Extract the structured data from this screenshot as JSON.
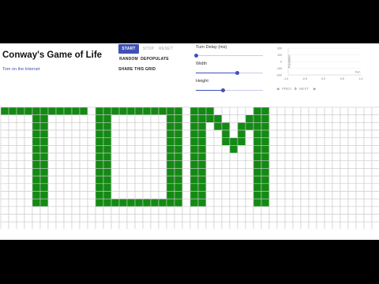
{
  "header": {
    "title": "Conway's Game of Life",
    "link": "Tom on the Internet"
  },
  "controls": {
    "start": "START",
    "stop": "STOP",
    "reset": "RESET",
    "random": "RANDOM",
    "depopulate": "DEPOPULATE",
    "share": "SHARE THIS GRID"
  },
  "sliders": [
    {
      "label": "Turn Delay (ms)",
      "value_fraction": 0.0
    },
    {
      "label": "Width",
      "value_fraction": 0.62
    },
    {
      "label": "Height",
      "value_fraction": 0.4
    }
  ],
  "chart_data": {
    "type": "line",
    "ylabel": "Population",
    "xlabel": "Turn",
    "y_ticks": [
      "200",
      "100",
      "0",
      "-100",
      "-200"
    ],
    "x_ticks": [
      "-1.0",
      "-0.5",
      "0.0",
      "0.5",
      "1.0"
    ],
    "xlim": [
      -1,
      1
    ],
    "ylim": [
      -200,
      200
    ],
    "series": []
  },
  "pager": {
    "prev": "PREV",
    "page": "0",
    "next": "NEXT"
  },
  "grid": {
    "cols": 48,
    "rows": 16,
    "cell_color": "#138a13",
    "line_color": "#c9c9c9",
    "live": [
      [
        0,
        0
      ],
      [
        0,
        1
      ],
      [
        0,
        2
      ],
      [
        0,
        3
      ],
      [
        0,
        4
      ],
      [
        0,
        5
      ],
      [
        0,
        6
      ],
      [
        0,
        7
      ],
      [
        0,
        8
      ],
      [
        0,
        9
      ],
      [
        0,
        10
      ],
      [
        1,
        4
      ],
      [
        1,
        5
      ],
      [
        2,
        4
      ],
      [
        2,
        5
      ],
      [
        3,
        4
      ],
      [
        3,
        5
      ],
      [
        4,
        4
      ],
      [
        4,
        5
      ],
      [
        5,
        4
      ],
      [
        5,
        5
      ],
      [
        6,
        4
      ],
      [
        6,
        5
      ],
      [
        7,
        4
      ],
      [
        7,
        5
      ],
      [
        8,
        4
      ],
      [
        8,
        5
      ],
      [
        9,
        4
      ],
      [
        9,
        5
      ],
      [
        10,
        4
      ],
      [
        10,
        5
      ],
      [
        11,
        4
      ],
      [
        11,
        5
      ],
      [
        12,
        4
      ],
      [
        12,
        5
      ],
      [
        0,
        12
      ],
      [
        0,
        13
      ],
      [
        0,
        14
      ],
      [
        0,
        15
      ],
      [
        0,
        16
      ],
      [
        0,
        17
      ],
      [
        0,
        18
      ],
      [
        0,
        19
      ],
      [
        0,
        20
      ],
      [
        0,
        21
      ],
      [
        0,
        22
      ],
      [
        1,
        12
      ],
      [
        1,
        13
      ],
      [
        1,
        21
      ],
      [
        1,
        22
      ],
      [
        2,
        12
      ],
      [
        2,
        13
      ],
      [
        2,
        21
      ],
      [
        2,
        22
      ],
      [
        3,
        12
      ],
      [
        3,
        13
      ],
      [
        3,
        21
      ],
      [
        3,
        22
      ],
      [
        4,
        12
      ],
      [
        4,
        13
      ],
      [
        4,
        21
      ],
      [
        4,
        22
      ],
      [
        5,
        12
      ],
      [
        5,
        13
      ],
      [
        5,
        21
      ],
      [
        5,
        22
      ],
      [
        6,
        12
      ],
      [
        6,
        13
      ],
      [
        6,
        21
      ],
      [
        6,
        22
      ],
      [
        7,
        12
      ],
      [
        7,
        13
      ],
      [
        7,
        21
      ],
      [
        7,
        22
      ],
      [
        8,
        12
      ],
      [
        8,
        13
      ],
      [
        8,
        21
      ],
      [
        8,
        22
      ],
      [
        9,
        12
      ],
      [
        9,
        13
      ],
      [
        9,
        21
      ],
      [
        9,
        22
      ],
      [
        10,
        12
      ],
      [
        10,
        13
      ],
      [
        10,
        21
      ],
      [
        10,
        22
      ],
      [
        11,
        12
      ],
      [
        11,
        13
      ],
      [
        11,
        21
      ],
      [
        11,
        22
      ],
      [
        12,
        12
      ],
      [
        12,
        13
      ],
      [
        12,
        14
      ],
      [
        12,
        15
      ],
      [
        12,
        16
      ],
      [
        12,
        17
      ],
      [
        12,
        18
      ],
      [
        12,
        19
      ],
      [
        12,
        20
      ],
      [
        12,
        21
      ],
      [
        12,
        22
      ],
      [
        0,
        24
      ],
      [
        0,
        25
      ],
      [
        0,
        26
      ],
      [
        0,
        32
      ],
      [
        0,
        33
      ],
      [
        1,
        24
      ],
      [
        1,
        25
      ],
      [
        1,
        26
      ],
      [
        1,
        27
      ],
      [
        1,
        31
      ],
      [
        1,
        32
      ],
      [
        1,
        33
      ],
      [
        2,
        24
      ],
      [
        2,
        25
      ],
      [
        2,
        27
      ],
      [
        2,
        28
      ],
      [
        2,
        30
      ],
      [
        2,
        31
      ],
      [
        2,
        32
      ],
      [
        2,
        33
      ],
      [
        3,
        24
      ],
      [
        3,
        25
      ],
      [
        3,
        28
      ],
      [
        3,
        30
      ],
      [
        3,
        32
      ],
      [
        3,
        33
      ],
      [
        4,
        24
      ],
      [
        4,
        25
      ],
      [
        4,
        28
      ],
      [
        4,
        29
      ],
      [
        4,
        30
      ],
      [
        4,
        32
      ],
      [
        4,
        33
      ],
      [
        5,
        24
      ],
      [
        5,
        25
      ],
      [
        5,
        29
      ],
      [
        5,
        32
      ],
      [
        5,
        33
      ],
      [
        6,
        24
      ],
      [
        6,
        25
      ],
      [
        6,
        32
      ],
      [
        6,
        33
      ],
      [
        7,
        24
      ],
      [
        7,
        25
      ],
      [
        7,
        32
      ],
      [
        7,
        33
      ],
      [
        8,
        24
      ],
      [
        8,
        25
      ],
      [
        8,
        32
      ],
      [
        8,
        33
      ],
      [
        9,
        24
      ],
      [
        9,
        25
      ],
      [
        9,
        32
      ],
      [
        9,
        33
      ],
      [
        10,
        24
      ],
      [
        10,
        25
      ],
      [
        10,
        32
      ],
      [
        10,
        33
      ],
      [
        11,
        24
      ],
      [
        11,
        25
      ],
      [
        11,
        32
      ],
      [
        11,
        33
      ],
      [
        12,
        24
      ],
      [
        12,
        25
      ],
      [
        12,
        32
      ],
      [
        12,
        33
      ]
    ]
  }
}
